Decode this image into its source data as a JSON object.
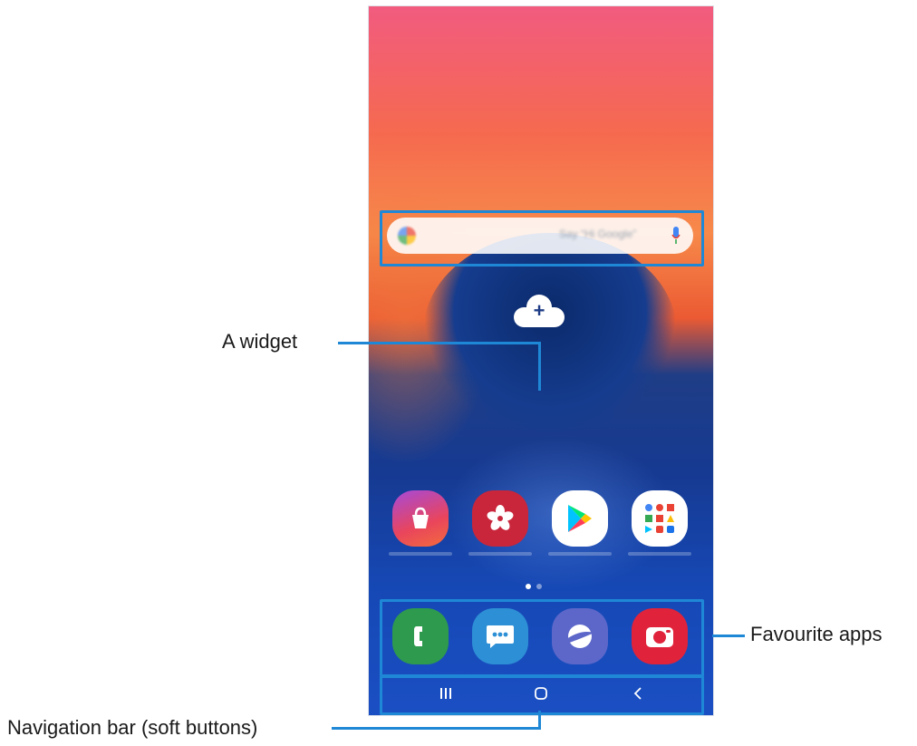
{
  "labels": {
    "widget": "A widget",
    "favourites": "Favourite apps",
    "navigation": "Navigation bar (soft buttons)"
  },
  "home_screen": {
    "add_widget_icon": "cloud-plus-icon",
    "search_widget": {
      "hint": "Say “Hi Google”",
      "icons": [
        "google-logo-icon",
        "microphone-icon"
      ]
    },
    "apps": [
      {
        "icon": "galaxy-store-icon",
        "color": "#e9455c"
      },
      {
        "icon": "gallery-flower-icon",
        "color": "#c9263b"
      },
      {
        "icon": "play-store-icon",
        "color": "#ffffff"
      },
      {
        "icon": "google-folder-icon",
        "color": "#ffffff"
      }
    ],
    "favourites": [
      {
        "icon": "phone-icon",
        "color": "#2e9a4e"
      },
      {
        "icon": "messages-icon",
        "color": "#2d8fd5"
      },
      {
        "icon": "internet-icon",
        "color": "#5c67c9"
      },
      {
        "icon": "camera-icon",
        "color": "#e0233b"
      }
    ],
    "navigation": [
      "recents-icon",
      "home-icon",
      "back-icon"
    ]
  },
  "colors": {
    "annotation": "#1f88d6"
  }
}
